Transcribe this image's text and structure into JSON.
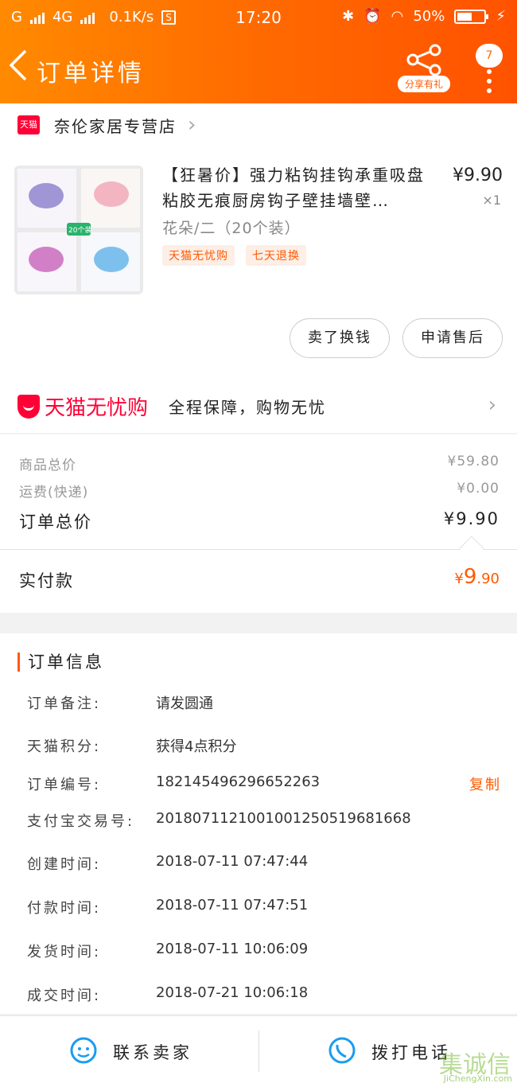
{
  "status_bar": {
    "carrier": "G",
    "network": "4G",
    "speed": "0.1K/s",
    "time": "17:20",
    "battery": "50%"
  },
  "header": {
    "title": "订单详情",
    "share_label": "分享有礼",
    "badge": "7"
  },
  "shop": {
    "logo_text": "天猫",
    "name": "奈伦家居专营店"
  },
  "product": {
    "image_tag": "20个装",
    "title": "【狂暑价】强力粘钩挂钩承重吸盘粘胶无痕厨房钩子壁挂墙壁…",
    "price": "¥9.90",
    "quantity": "×1",
    "sku": "花朵/二（20个装）",
    "tags": [
      "天猫无忧购",
      "七天退换"
    ]
  },
  "actions": {
    "sell": "卖了换钱",
    "after_sale": "申请售后"
  },
  "guarantee": {
    "logo_text": "天猫无忧购",
    "text": "全程保障，购物无忧"
  },
  "price_summary": {
    "goods_total_label": "商品总价",
    "goods_total": "¥59.80",
    "shipping_label": "运费(快递)",
    "shipping": "¥0.00",
    "order_total_label": "订单总价",
    "order_total": "¥9.90",
    "paid_label": "实付款",
    "paid_currency": "¥",
    "paid_int": "9",
    "paid_dec": ".90"
  },
  "order_info": {
    "heading": "订单信息",
    "rows": [
      {
        "label": "订单备注:",
        "value": "请发圆通"
      },
      {
        "label": "天猫积分:",
        "value": "获得4点积分"
      },
      {
        "label": "订单编号:",
        "value": "182145496296652263"
      },
      {
        "label": "支付宝交易号:",
        "value": "2018071121001001250519681668"
      },
      {
        "label": "创建时间:",
        "value": "2018-07-11 07:47:44"
      },
      {
        "label": "付款时间:",
        "value": "2018-07-11 07:47:51"
      },
      {
        "label": "发货时间:",
        "value": "2018-07-11 10:06:09"
      },
      {
        "label": "成交时间:",
        "value": "2018-07-21 10:06:18"
      }
    ],
    "copy_label": "复制"
  },
  "bottom_bar": {
    "contact_seller": "联系卖家",
    "call_phone": "拨打电话"
  },
  "watermark": {
    "text": "集诚信",
    "url_text": "JiChengXin.com"
  },
  "colors": {
    "accent": "#ff5a00",
    "tmall_red": "#ff0036"
  }
}
